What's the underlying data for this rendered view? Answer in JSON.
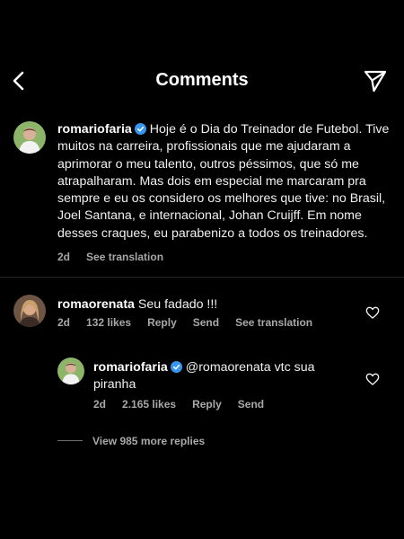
{
  "header": {
    "title": "Comments",
    "back_icon": "chevron-left-icon",
    "share_icon": "paper-plane-icon"
  },
  "caption": {
    "username": "romariofaria",
    "text": "Hoje é o Dia do Treinador de Futebol. Tive muitos na carreira, profissionais que me ajudaram a aprimorar o meu talento, outros péssimos, que só me atrapalharam. Mas dois em especial me marcaram pra sempre e eu os considero os melhores que tive: no Brasil, Joel Santana, e internacional, Johan Cruijff. Em nome desses craques, eu parabenizo a todos os treinadores.",
    "time": "2d",
    "translate": "See translation"
  },
  "comments": [
    {
      "username": "romaorenata",
      "text": "Seu fadado !!!",
      "time": "2d",
      "likes": "132 likes",
      "reply": "Reply",
      "send": "Send",
      "translate": "See translation"
    }
  ],
  "reply": {
    "username": "romariofaria",
    "text": "@romaorenata vtc sua piranha",
    "time": "2d",
    "likes": "2.165 likes",
    "reply": "Reply",
    "send": "Send"
  },
  "more_replies": "View 985 more replies",
  "colors": {
    "background": "#000000",
    "text": "#f0f0f0",
    "muted": "#a8a8a8",
    "verified": "#3797f0"
  }
}
